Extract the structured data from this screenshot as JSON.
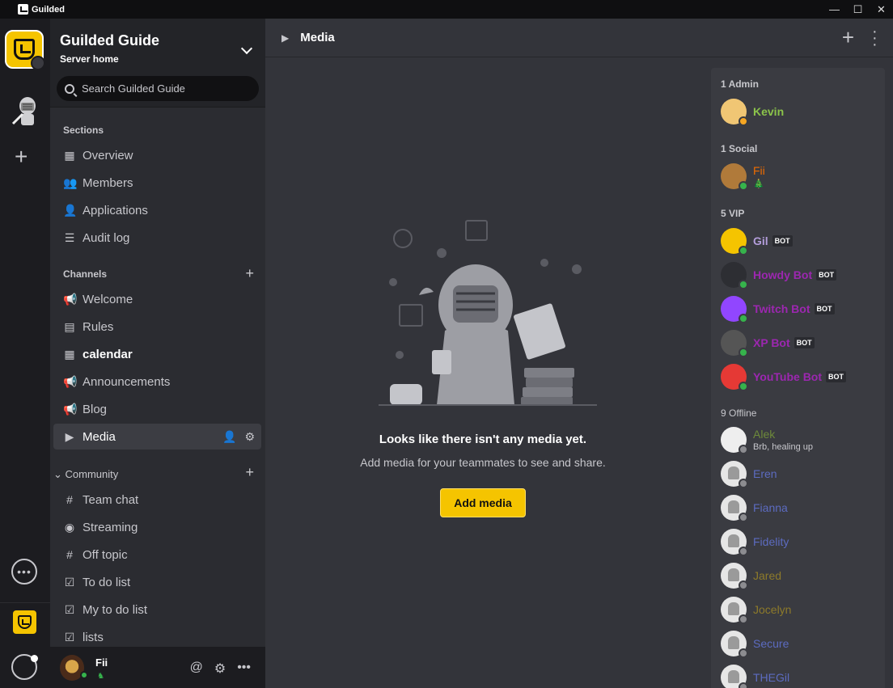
{
  "app": {
    "title": "Guilded"
  },
  "window_controls": {
    "minimize": "—",
    "maximize": "☐",
    "close": "✕"
  },
  "server": {
    "name": "Guilded Guide",
    "subtitle": "Server home",
    "search_placeholder": "Search Guilded Guide"
  },
  "sections": {
    "label": "Sections",
    "items": [
      {
        "label": "Overview",
        "icon": "grid-icon"
      },
      {
        "label": "Members",
        "icon": "members-icon"
      },
      {
        "label": "Applications",
        "icon": "add-user-icon"
      },
      {
        "label": "Audit log",
        "icon": "clipboard-icon"
      }
    ]
  },
  "channels": {
    "label": "Channels",
    "items": [
      {
        "label": "Welcome",
        "icon": "megaphone-icon"
      },
      {
        "label": "Rules",
        "icon": "document-icon"
      },
      {
        "label": "calendar",
        "icon": "calendar-icon"
      },
      {
        "label": "Announcements",
        "icon": "megaphone-icon"
      },
      {
        "label": "Blog",
        "icon": "megaphone-icon"
      },
      {
        "label": "Media",
        "icon": "media-icon"
      }
    ]
  },
  "community": {
    "label": "Community",
    "items": [
      {
        "label": "Team chat",
        "icon": "hash-icon"
      },
      {
        "label": "Streaming",
        "icon": "broadcast-icon"
      },
      {
        "label": "Off topic",
        "icon": "hash-icon"
      },
      {
        "label": "To do list",
        "icon": "checkbox-icon"
      },
      {
        "label": "My to do list",
        "icon": "checkbox-icon"
      },
      {
        "label": "lists",
        "icon": "checkbox-icon"
      }
    ]
  },
  "user": {
    "name": "Fii",
    "status_emoji": "♞"
  },
  "main": {
    "channel_title": "Media",
    "empty_title": "Looks like there isn't any media yet.",
    "empty_subtitle": "Add media for your teammates to see and share.",
    "add_button": "Add media"
  },
  "members": {
    "groups": [
      {
        "label": "1 Admin",
        "members": [
          {
            "name": "Kevin",
            "color": "#8bc34a",
            "status": "away",
            "avatar_color": "#f0c674"
          }
        ]
      },
      {
        "label": "1 Social",
        "members": [
          {
            "name": "Fii",
            "color": "#ef6c00",
            "status": "online",
            "sub": "🎄",
            "avatar_color": "#b07a3a"
          }
        ]
      },
      {
        "label": "5 VIP",
        "members": [
          {
            "name": "Gil",
            "color": "#b39ddb",
            "bot": "BOT",
            "status": "online",
            "avatar_color": "#f5c400"
          },
          {
            "name": "Howdy Bot",
            "color": "#9c27b0",
            "bot": "BOT",
            "status": "online",
            "avatar_color": "#2d2e33"
          },
          {
            "name": "Twitch Bot",
            "color": "#9c27b0",
            "bot": "BOT",
            "status": "online",
            "avatar_color": "#9146ff"
          },
          {
            "name": "XP Bot",
            "color": "#9c27b0",
            "bot": "BOT",
            "status": "online",
            "avatar_color": "#555"
          },
          {
            "name": "YouTube Bot",
            "color": "#9c27b0",
            "bot": "BOT",
            "status": "online",
            "avatar_color": "#e53935"
          }
        ]
      },
      {
        "label": "9 Offline",
        "members": [
          {
            "name": "Alek",
            "color": "#6d8a3a",
            "status": "offline",
            "sub": "Brb, healing up",
            "avatar_color": "#eee"
          },
          {
            "name": "Eren",
            "color": "#5c6bc0",
            "status": "offline"
          },
          {
            "name": "Fianna",
            "color": "#5c6bc0",
            "status": "offline"
          },
          {
            "name": "Fidelity",
            "color": "#5c6bc0",
            "status": "offline"
          },
          {
            "name": "Jared",
            "color": "#8d7a2a",
            "status": "offline"
          },
          {
            "name": "Jocelyn",
            "color": "#8d7a2a",
            "status": "offline"
          },
          {
            "name": "Secure",
            "color": "#5c6bc0",
            "status": "offline"
          },
          {
            "name": "THEGil",
            "color": "#5c6bc0",
            "status": "offline"
          }
        ]
      }
    ],
    "status_colors": {
      "online": "#36b34c",
      "away": "#f5a623",
      "offline": "#8c8c90"
    }
  }
}
